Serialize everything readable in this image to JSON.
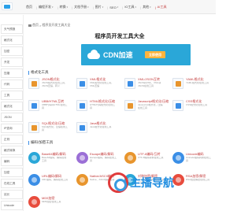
{
  "nav": [
    {
      "label": "首页",
      "caret": false,
      "hot": false
    },
    {
      "label": "编程开发",
      "caret": true,
      "hot": false
    },
    {
      "label": "转换",
      "caret": true,
      "hot": false
    },
    {
      "label": "文档手册",
      "caret": true,
      "hot": false
    },
    {
      "label": "图片",
      "caret": true,
      "hot": false
    },
    {
      "label": "SEO",
      "caret": true,
      "hot": false
    },
    {
      "label": "IO工具",
      "caret": true,
      "hot": false
    },
    {
      "label": "其他",
      "caret": true,
      "hot": false
    },
    {
      "label": "AI工具",
      "caret": false,
      "hot": true
    }
  ],
  "sidebar": {
    "items": [
      "天气预报",
      "",
      "",
      "",
      "",
      "",
      "",
      "",
      "",
      "",
      "",
      "",
      "",
      "",
      "",
      "",
      ""
    ],
    "visible_fragments": [
      "天气预报",
      "格式化",
      "加密",
      "开发",
      "压缩",
      "代码",
      "工具",
      "格式化",
      "JSON",
      "IP查询",
      "正则",
      "格式转换",
      "编码",
      "加密",
      "在线工具",
      "站长",
      "Unicode"
    ]
  },
  "breadcrumb": {
    "home": "首页",
    "sep": ">",
    "current": "程序员开发工具大全"
  },
  "page_title": "程序员开发工具大全",
  "banner": {
    "title": "CDN加速",
    "button": "立即使用",
    "bg_color": "#2aa7d8",
    "button_color": "#ffb43d"
  },
  "sections": [
    {
      "title": "格式化工具",
      "tools": [
        {
          "name": "JSON格式化",
          "desc": "JSON格式化在线工具，JSON压缩、转义",
          "icon": "json-icon",
          "color": "#e8952d"
        },
        {
          "name": "XML格式化",
          "desc": "XML格式化在线工具，XML压缩",
          "icon": "xml-icon",
          "color": "#3a8ee6"
        },
        {
          "name": "XML/JSON互转",
          "desc": "JSON转XML，XML转JSON在线工具",
          "icon": "xml-json-icon",
          "color": "#3a8ee6"
        },
        {
          "name": "YAML格式化",
          "desc": "YAML格式化在线工具",
          "icon": "yaml-icon",
          "color": "#e8952d"
        },
        {
          "name": "UBB/HTML互转",
          "desc": "UBB代码转HTML在线工具",
          "icon": "ubb-icon",
          "color": "#3a8ee6"
        },
        {
          "name": "HTML格式化/压缩",
          "desc": "HTML代码格式化在线工具",
          "icon": "html-icon",
          "color": "#3a8ee6"
        },
        {
          "name": "Javascript格式化/压缩",
          "desc": "Javascript格式化，压缩在线工具",
          "icon": "js-icon",
          "color": "#e8952d"
        },
        {
          "name": "CSS格式化",
          "desc": "CSS格式化在线工具",
          "icon": "css-icon",
          "color": "#3a8ee6"
        },
        {
          "name": "SQL格式化/压缩",
          "desc": "SQL格式化，压缩在线工具",
          "icon": "sql-icon",
          "color": "#e8952d"
        },
        {
          "name": "Java格式化",
          "desc": "Java格式化在线工具",
          "icon": "java-icon",
          "color": "#3a8ee6"
        }
      ]
    },
    {
      "title": "编码/加密工具",
      "tools": [
        {
          "name": "Base64编码/解码",
          "desc": "Base64编码、解码在线工具",
          "icon": "base64-icon",
          "color": "#2aa7d8"
        },
        {
          "name": "Escape编码/解码",
          "desc": "Escape编码、解码在线工具",
          "icon": "escape-icon",
          "color": "#9b6fd6"
        },
        {
          "name": "UTF-8编码/互转",
          "desc": "UTF-8编码转换在线工具",
          "icon": "utf8-icon",
          "color": "#e8952d"
        },
        {
          "name": "Unicode编码",
          "desc": "Unicode编码转换在线工具",
          "icon": "unicode-icon",
          "color": "#3a8ee6"
        },
        {
          "name": "URL编码/解码",
          "desc": "URL编码、解码在线工具",
          "icon": "url-icon",
          "color": "#3a8ee6"
        },
        {
          "name": "Native/ASCII编码",
          "desc": "Native、ASCII编码互转",
          "icon": "native-icon",
          "color": "#e8952d"
        },
        {
          "name": "对称加密/解密",
          "desc": "AES、DES对称加密在线工具",
          "icon": "aes-icon",
          "color": "#2aa7d8"
        },
        {
          "name": "RSA加密/解密",
          "desc": "RSA加密解密在线工具",
          "icon": "rsa-icon",
          "color": "#e84c3d"
        },
        {
          "name": "MD5加密",
          "desc": "MD5加密在线工具",
          "icon": "md5-icon",
          "color": "#e84c3d"
        }
      ]
    }
  ],
  "watermark": "主播导航"
}
